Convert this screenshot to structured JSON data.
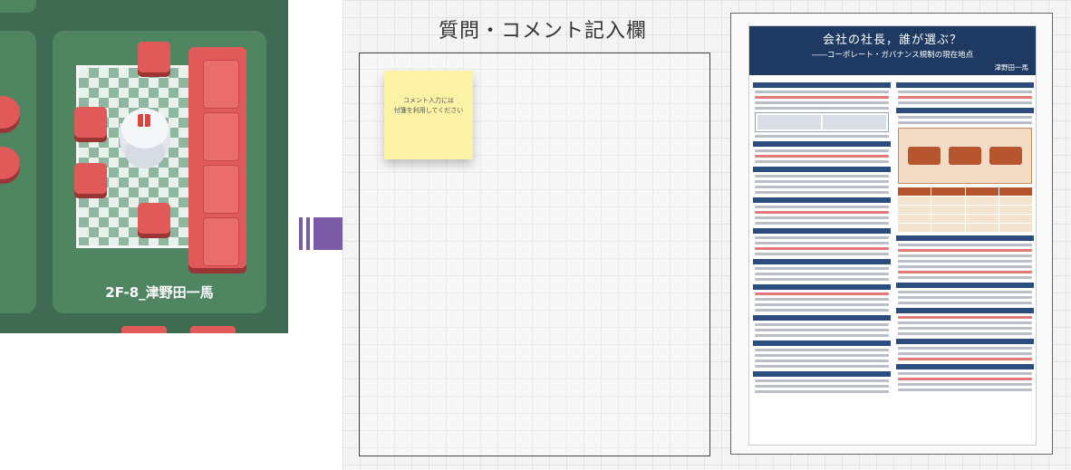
{
  "venue": {
    "room_label": "2F-8_津野田一馬"
  },
  "board": {
    "title": "質問・コメント記入欄",
    "sticky_note": "コメント入力には\n付箋を利用してください"
  },
  "poster": {
    "title": "会社の社長，誰が選ぶ？",
    "subtitle": "――コーポレート・ガバナンス規制の現在地点",
    "author": "津野田一馬"
  },
  "colors": {
    "venue_bg": "#3f6b52",
    "room_floor": "#4f8561",
    "furniture": "#e05a5a",
    "arrow": "#7b5aa6",
    "poster_header": "#1e3a63"
  }
}
